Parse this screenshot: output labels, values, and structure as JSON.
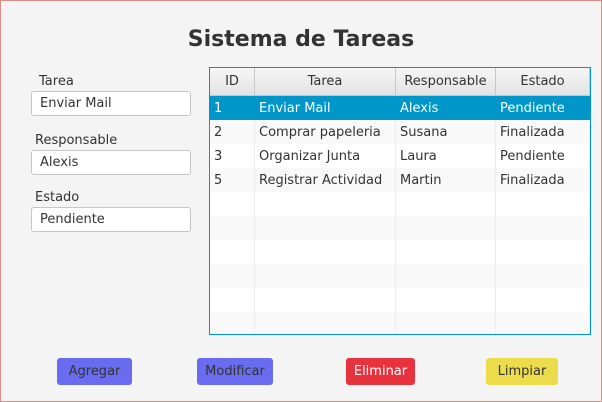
{
  "app": {
    "title": "Sistema de Tareas"
  },
  "form": {
    "tarea": {
      "label": "Tarea",
      "value": "Enviar Mail"
    },
    "responsable": {
      "label": "Responsable",
      "value": "Alexis"
    },
    "estado": {
      "label": "Estado",
      "value": "Pendiente"
    }
  },
  "table": {
    "headers": [
      "ID",
      "Tarea",
      "Responsable",
      "Estado"
    ],
    "rows": [
      {
        "id": "1",
        "tarea": "Enviar Mail",
        "responsable": "Alexis",
        "estado": "Pendiente"
      },
      {
        "id": "2",
        "tarea": "Comprar papeleria",
        "responsable": "Susana",
        "estado": "Finalizada"
      },
      {
        "id": "3",
        "tarea": "Organizar Junta",
        "responsable": "Laura",
        "estado": "Pendiente"
      },
      {
        "id": "5",
        "tarea": "Registrar Actividad",
        "responsable": "Martin",
        "estado": "Finalizada"
      }
    ],
    "selected_row": 0,
    "selection_color": "#0096c9"
  },
  "buttons": {
    "agregar": {
      "label": "Agregar",
      "color": "#6a6cf0"
    },
    "modificar": {
      "label": "Modificar",
      "color": "#6a6cf0"
    },
    "eliminar": {
      "label": "Eliminar",
      "color": "#e8333f"
    },
    "limpiar": {
      "label": "Limpiar",
      "color": "#ecdb4b"
    }
  }
}
